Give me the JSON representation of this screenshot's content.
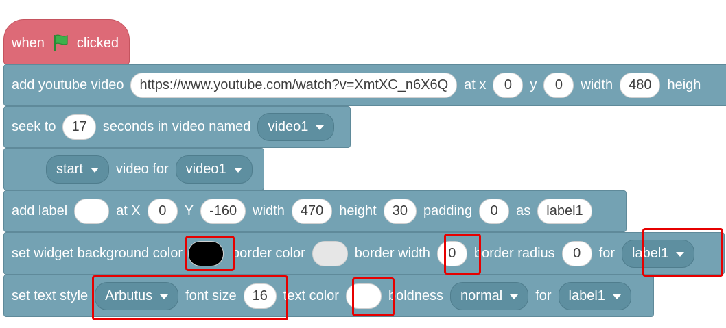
{
  "hat_block": {
    "word1": "when",
    "icon": "green-flag-icon",
    "word2": "clicked"
  },
  "youtube_block": {
    "label": "add youtube video",
    "url": "https://www.youtube.com/watch?v=XmtXC_n6X6Q",
    "at_x": "at x",
    "x": "0",
    "y_label": "y",
    "y": "0",
    "width_label": "width",
    "width": "480",
    "height_label": "heigh"
  },
  "seek_block": {
    "label": "seek to",
    "seconds": "17",
    "mid": "seconds in video named",
    "video": "video1"
  },
  "start_block": {
    "action": "start",
    "mid": "video for",
    "video": "video1"
  },
  "label_block": {
    "label": "add label",
    "text": "",
    "at_x": "at X",
    "x": "0",
    "y_label": "Y",
    "y": "-160",
    "width_label": "width",
    "width": "470",
    "height_label": "height",
    "height": "30",
    "padding_label": "padding",
    "padding": "0",
    "as_label": "as",
    "name": "label1"
  },
  "widget_bg_block": {
    "label": "set widget background color",
    "border_color_label": "border color",
    "border_width_label": "border width",
    "border_width": "0",
    "border_radius_label": "border radius",
    "border_radius": "0",
    "for_label": "for",
    "target": "label1",
    "bg_color": "#000000",
    "border_color": "#e6e6e6"
  },
  "text_style_block": {
    "label": "set text style",
    "font": "Arbutus",
    "font_size_label": "font size",
    "font_size": "16",
    "text_color_label": "text color",
    "text_color": "#ffffff",
    "boldness_label": "boldness",
    "boldness": "normal",
    "for_label": "for",
    "target": "label1"
  },
  "colors": {
    "block": "#74a2b3",
    "hat": "#dd6a77",
    "highlight": "#e60000",
    "flag": "#3fb04b"
  }
}
